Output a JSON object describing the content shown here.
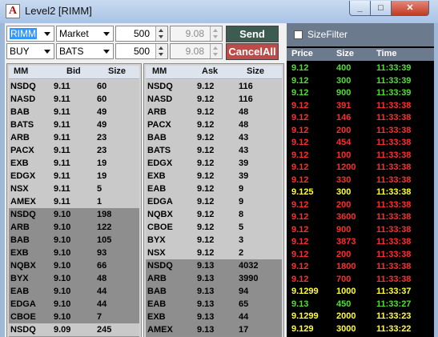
{
  "window": {
    "title": "Level2 [RIMM]"
  },
  "controls": {
    "symbol": "RIMM",
    "order_type": "Market",
    "qty1": "500",
    "price1": "9.08",
    "send_label": "Send",
    "side": "BUY",
    "route": "BATS",
    "qty2": "500",
    "price2": "9.08",
    "cancel_label": "CancelAll",
    "size_filter_label": "SizeFilter",
    "size_filter_checked": false
  },
  "colors": {
    "book_light": "#c9c9c9",
    "book_dark": "#8e8e8e",
    "tape_green": "#55dd33",
    "tape_red": "#ff2e2e",
    "tape_yellow": "#ffff33"
  },
  "bid_book": {
    "headers": [
      "MM",
      "Bid",
      "Size"
    ],
    "rows": [
      {
        "mm": "NSDQ",
        "price": "9.11",
        "size": "60",
        "shade": "light"
      },
      {
        "mm": "NASD",
        "price": "9.11",
        "size": "60",
        "shade": "light"
      },
      {
        "mm": "BAB",
        "price": "9.11",
        "size": "49",
        "shade": "light"
      },
      {
        "mm": "BATS",
        "price": "9.11",
        "size": "49",
        "shade": "light"
      },
      {
        "mm": "ARB",
        "price": "9.11",
        "size": "23",
        "shade": "light"
      },
      {
        "mm": "PACX",
        "price": "9.11",
        "size": "23",
        "shade": "light"
      },
      {
        "mm": "EXB",
        "price": "9.11",
        "size": "19",
        "shade": "light"
      },
      {
        "mm": "EDGX",
        "price": "9.11",
        "size": "19",
        "shade": "light"
      },
      {
        "mm": "NSX",
        "price": "9.11",
        "size": "5",
        "shade": "light"
      },
      {
        "mm": "AMEX",
        "price": "9.11",
        "size": "1",
        "shade": "light"
      },
      {
        "mm": "NSDQ",
        "price": "9.10",
        "size": "198",
        "shade": "dark"
      },
      {
        "mm": "ARB",
        "price": "9.10",
        "size": "122",
        "shade": "dark"
      },
      {
        "mm": "BAB",
        "price": "9.10",
        "size": "105",
        "shade": "dark"
      },
      {
        "mm": "EXB",
        "price": "9.10",
        "size": "93",
        "shade": "dark"
      },
      {
        "mm": "NQBX",
        "price": "9.10",
        "size": "66",
        "shade": "dark"
      },
      {
        "mm": "BYX",
        "price": "9.10",
        "size": "48",
        "shade": "dark"
      },
      {
        "mm": "EAB",
        "price": "9.10",
        "size": "44",
        "shade": "dark"
      },
      {
        "mm": "EDGA",
        "price": "9.10",
        "size": "44",
        "shade": "dark"
      },
      {
        "mm": "CBOE",
        "price": "9.10",
        "size": "7",
        "shade": "dark"
      },
      {
        "mm": "NSDQ",
        "price": "9.09",
        "size": "245",
        "shade": "light"
      }
    ]
  },
  "ask_book": {
    "headers": [
      "MM",
      "Ask",
      "Size"
    ],
    "rows": [
      {
        "mm": "NSDQ",
        "price": "9.12",
        "size": "116",
        "shade": "light"
      },
      {
        "mm": "NASD",
        "price": "9.12",
        "size": "116",
        "shade": "light"
      },
      {
        "mm": "ARB",
        "price": "9.12",
        "size": "48",
        "shade": "light"
      },
      {
        "mm": "PACX",
        "price": "9.12",
        "size": "48",
        "shade": "light"
      },
      {
        "mm": "BAB",
        "price": "9.12",
        "size": "43",
        "shade": "light"
      },
      {
        "mm": "BATS",
        "price": "9.12",
        "size": "43",
        "shade": "light"
      },
      {
        "mm": "EDGX",
        "price": "9.12",
        "size": "39",
        "shade": "light"
      },
      {
        "mm": "EXB",
        "price": "9.12",
        "size": "39",
        "shade": "light"
      },
      {
        "mm": "EAB",
        "price": "9.12",
        "size": "9",
        "shade": "light"
      },
      {
        "mm": "EDGA",
        "price": "9.12",
        "size": "9",
        "shade": "light"
      },
      {
        "mm": "NQBX",
        "price": "9.12",
        "size": "8",
        "shade": "light"
      },
      {
        "mm": "CBOE",
        "price": "9.12",
        "size": "5",
        "shade": "light"
      },
      {
        "mm": "BYX",
        "price": "9.12",
        "size": "3",
        "shade": "light"
      },
      {
        "mm": "NSX",
        "price": "9.12",
        "size": "2",
        "shade": "light"
      },
      {
        "mm": "NSDQ",
        "price": "9.13",
        "size": "4032",
        "shade": "dark"
      },
      {
        "mm": "ARB",
        "price": "9.13",
        "size": "3990",
        "shade": "dark"
      },
      {
        "mm": "BAB",
        "price": "9.13",
        "size": "94",
        "shade": "dark"
      },
      {
        "mm": "EAB",
        "price": "9.13",
        "size": "65",
        "shade": "dark"
      },
      {
        "mm": "EXB",
        "price": "9.13",
        "size": "44",
        "shade": "dark"
      },
      {
        "mm": "AMEX",
        "price": "9.13",
        "size": "17",
        "shade": "dark"
      }
    ]
  },
  "time_sales": {
    "headers": [
      "Price",
      "Size",
      "Time"
    ],
    "rows": [
      {
        "price": "9.12",
        "size": "400",
        "time": "11:33:39",
        "color": "green"
      },
      {
        "price": "9.12",
        "size": "300",
        "time": "11:33:39",
        "color": "green"
      },
      {
        "price": "9.12",
        "size": "900",
        "time": "11:33:39",
        "color": "green"
      },
      {
        "price": "9.12",
        "size": "391",
        "time": "11:33:38",
        "color": "red"
      },
      {
        "price": "9.12",
        "size": "146",
        "time": "11:33:38",
        "color": "red"
      },
      {
        "price": "9.12",
        "size": "200",
        "time": "11:33:38",
        "color": "red"
      },
      {
        "price": "9.12",
        "size": "454",
        "time": "11:33:38",
        "color": "red"
      },
      {
        "price": "9.12",
        "size": "100",
        "time": "11:33:38",
        "color": "red"
      },
      {
        "price": "9.12",
        "size": "1200",
        "time": "11:33:38",
        "color": "red"
      },
      {
        "price": "9.12",
        "size": "330",
        "time": "11:33:38",
        "color": "red"
      },
      {
        "price": "9.125",
        "size": "300",
        "time": "11:33:38",
        "color": "yellow"
      },
      {
        "price": "9.12",
        "size": "200",
        "time": "11:33:38",
        "color": "red"
      },
      {
        "price": "9.12",
        "size": "3600",
        "time": "11:33:38",
        "color": "red"
      },
      {
        "price": "9.12",
        "size": "900",
        "time": "11:33:38",
        "color": "red"
      },
      {
        "price": "9.12",
        "size": "3873",
        "time": "11:33:38",
        "color": "red"
      },
      {
        "price": "9.12",
        "size": "200",
        "time": "11:33:38",
        "color": "red"
      },
      {
        "price": "9.12",
        "size": "1800",
        "time": "11:33:38",
        "color": "red"
      },
      {
        "price": "9.12",
        "size": "700",
        "time": "11:33:38",
        "color": "red"
      },
      {
        "price": "9.1299",
        "size": "1000",
        "time": "11:33:37",
        "color": "yellow"
      },
      {
        "price": "9.13",
        "size": "450",
        "time": "11:33:27",
        "color": "green"
      },
      {
        "price": "9.1299",
        "size": "2000",
        "time": "11:33:23",
        "color": "yellow"
      },
      {
        "price": "9.129",
        "size": "3000",
        "time": "11:33:22",
        "color": "yellow"
      }
    ]
  }
}
